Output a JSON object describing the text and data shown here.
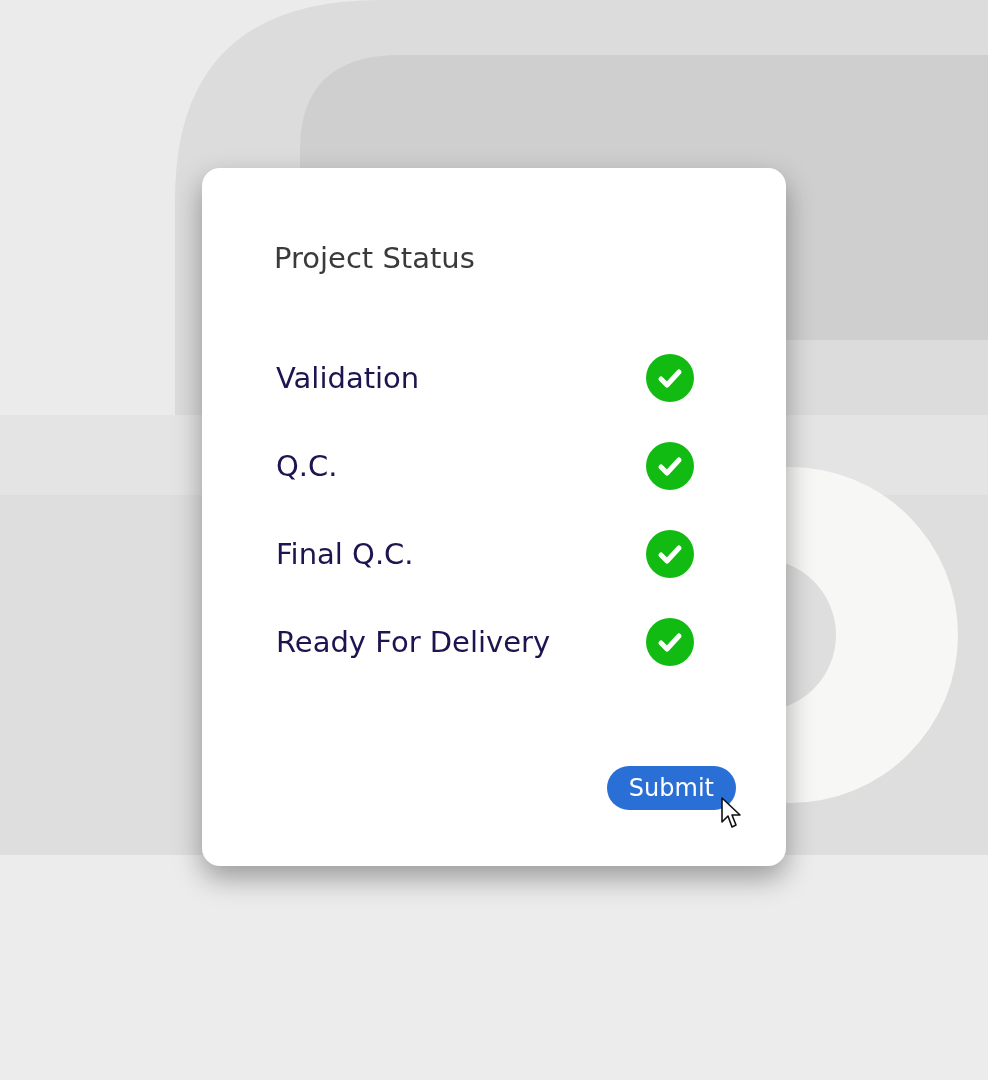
{
  "card": {
    "title": "Project Status",
    "steps": [
      {
        "label": "Validation",
        "checked": true
      },
      {
        "label": "Q.C.",
        "checked": true
      },
      {
        "label": "Final Q.C.",
        "checked": true
      },
      {
        "label": "Ready For Delivery",
        "checked": true
      }
    ],
    "button": "Submit"
  }
}
